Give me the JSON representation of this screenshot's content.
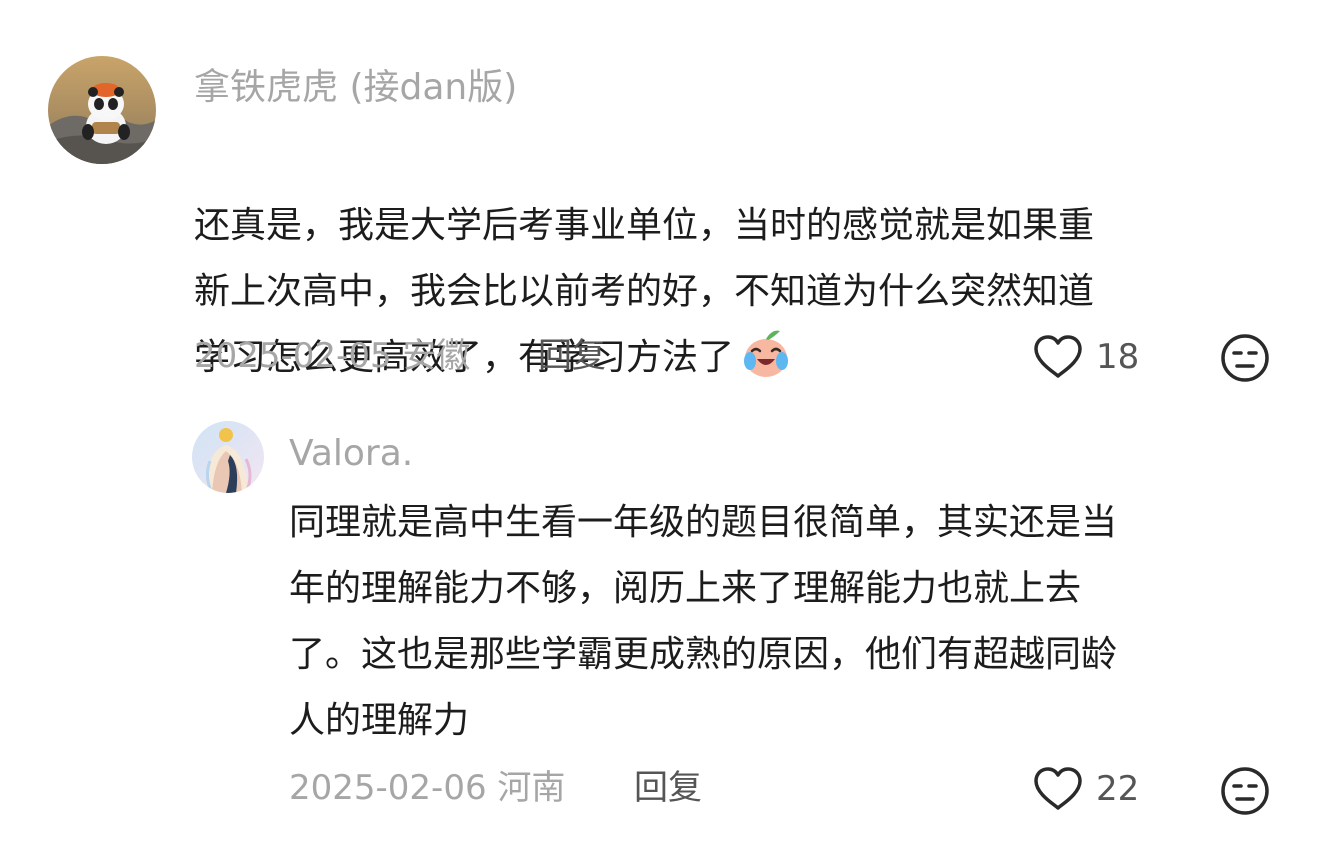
{
  "comment": {
    "username": "拿铁虎虎 (接dan版)",
    "text": "还真是，我是大学后考事业单位，当时的感觉就是如果重\n新上次高中，我会比以前考的好，不知道为什么突然知道\n学习怎么更高效了，有学习方法了",
    "emoji": "crying-laughing-peach-emoji",
    "date": "2025-02-05",
    "location": "安徽",
    "reply_label": "回复",
    "likes": "18",
    "like_icon": "heart-outline-icon",
    "dislike_icon": "neutral-face-icon"
  },
  "reply": {
    "username": "Valora.",
    "text": "同理就是高中生看一年级的题目很简单，其实还是当\n年的理解能力不够，阅历上来了理解能力也就上去\n了。这也是那些学霸更成熟的原因，他们有超越同龄\n人的理解力",
    "date": "2025-02-06",
    "location": "河南",
    "reply_label": "回复",
    "likes": "22",
    "like_icon": "heart-outline-icon",
    "dislike_icon": "neutral-face-icon"
  },
  "colors": {
    "text_primary": "#1c1c1c",
    "text_secondary": "#a6a6a6",
    "action_text": "#555555"
  }
}
